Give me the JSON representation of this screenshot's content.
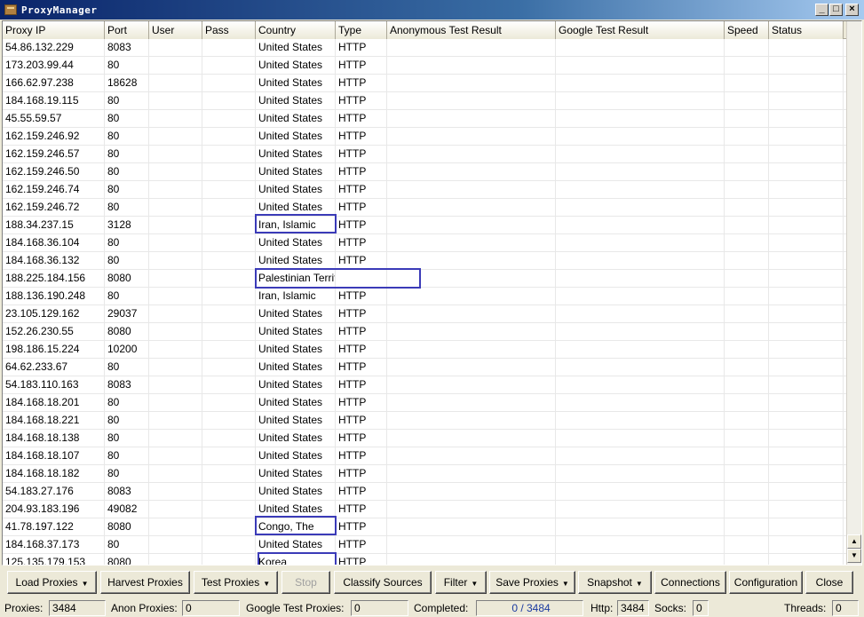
{
  "window": {
    "title": "ProxyManager",
    "minimize": "_",
    "maximize": "□",
    "close": "×"
  },
  "columns": [
    "Proxy IP",
    "Port",
    "User",
    "Pass",
    "Country",
    "Type",
    "Anonymous Test Result",
    "Google Test Result",
    "Speed",
    "Status"
  ],
  "rows": [
    [
      "54.86.132.229",
      "8083",
      "",
      "",
      "United States",
      "HTTP",
      "",
      "",
      "",
      ""
    ],
    [
      "173.203.99.44",
      "80",
      "",
      "",
      "United States",
      "HTTP",
      "",
      "",
      "",
      ""
    ],
    [
      "166.62.97.238",
      "18628",
      "",
      "",
      "United States",
      "HTTP",
      "",
      "",
      "",
      ""
    ],
    [
      "184.168.19.115",
      "80",
      "",
      "",
      "United States",
      "HTTP",
      "",
      "",
      "",
      ""
    ],
    [
      "45.55.59.57",
      "80",
      "",
      "",
      "United States",
      "HTTP",
      "",
      "",
      "",
      ""
    ],
    [
      "162.159.246.92",
      "80",
      "",
      "",
      "United States",
      "HTTP",
      "",
      "",
      "",
      ""
    ],
    [
      "162.159.246.57",
      "80",
      "",
      "",
      "United States",
      "HTTP",
      "",
      "",
      "",
      ""
    ],
    [
      "162.159.246.50",
      "80",
      "",
      "",
      "United States",
      "HTTP",
      "",
      "",
      "",
      ""
    ],
    [
      "162.159.246.74",
      "80",
      "",
      "",
      "United States",
      "HTTP",
      "",
      "",
      "",
      ""
    ],
    [
      "162.159.246.72",
      "80",
      "",
      "",
      "United States",
      "HTTP",
      "",
      "",
      "",
      ""
    ],
    [
      "188.34.237.15",
      "3128",
      "",
      "",
      "Iran, Islamic",
      "HTTP",
      "",
      "",
      "",
      ""
    ],
    [
      "184.168.36.104",
      "80",
      "",
      "",
      "United States",
      "HTTP",
      "",
      "",
      "",
      ""
    ],
    [
      "184.168.36.132",
      "80",
      "",
      "",
      "United States",
      "HTTP",
      "",
      "",
      "",
      ""
    ],
    [
      "188.225.184.156",
      "8080",
      "",
      "",
      "Palestinian Territory, Occupied",
      "",
      "",
      "",
      "",
      ""
    ],
    [
      "188.136.190.248",
      "80",
      "",
      "",
      "Iran, Islamic",
      "HTTP",
      "",
      "",
      "",
      ""
    ],
    [
      "23.105.129.162",
      "29037",
      "",
      "",
      "United States",
      "HTTP",
      "",
      "",
      "",
      ""
    ],
    [
      "152.26.230.55",
      "8080",
      "",
      "",
      "United States",
      "HTTP",
      "",
      "",
      "",
      ""
    ],
    [
      "198.186.15.224",
      "10200",
      "",
      "",
      "United States",
      "HTTP",
      "",
      "",
      "",
      ""
    ],
    [
      "64.62.233.67",
      "80",
      "",
      "",
      "United States",
      "HTTP",
      "",
      "",
      "",
      ""
    ],
    [
      "54.183.110.163",
      "8083",
      "",
      "",
      "United States",
      "HTTP",
      "",
      "",
      "",
      ""
    ],
    [
      "184.168.18.201",
      "80",
      "",
      "",
      "United States",
      "HTTP",
      "",
      "",
      "",
      ""
    ],
    [
      "184.168.18.221",
      "80",
      "",
      "",
      "United States",
      "HTTP",
      "",
      "",
      "",
      ""
    ],
    [
      "184.168.18.138",
      "80",
      "",
      "",
      "United States",
      "HTTP",
      "",
      "",
      "",
      ""
    ],
    [
      "184.168.18.107",
      "80",
      "",
      "",
      "United States",
      "HTTP",
      "",
      "",
      "",
      ""
    ],
    [
      "184.168.18.182",
      "80",
      "",
      "",
      "United States",
      "HTTP",
      "",
      "",
      "",
      ""
    ],
    [
      "54.183.27.176",
      "8083",
      "",
      "",
      "United States",
      "HTTP",
      "",
      "",
      "",
      ""
    ],
    [
      "204.93.183.196",
      "49082",
      "",
      "",
      "United States",
      "HTTP",
      "",
      "",
      "",
      ""
    ],
    [
      "41.78.197.122",
      "8080",
      "",
      "",
      "Congo, The",
      "HTTP",
      "",
      "",
      "",
      ""
    ],
    [
      "184.168.37.173",
      "80",
      "",
      "",
      "United States",
      "HTTP",
      "",
      "",
      "",
      ""
    ],
    [
      "125.135.179.153",
      "8080",
      "",
      "",
      "Korea",
      "HTTP",
      "",
      "",
      "",
      ""
    ]
  ],
  "scrollbar": {
    "up": "▲",
    "down": "▼"
  },
  "toolbar": {
    "load": "Load Proxies",
    "harvest": "Harvest Proxies",
    "test": "Test Proxies",
    "stop": "Stop",
    "classify": "Classify Sources",
    "filter": "Filter",
    "save": "Save Proxies",
    "snapshot": "Snapshot",
    "connections": "Connections",
    "configuration": "Configuration",
    "close": "Close",
    "dropdown_arrow": "▼"
  },
  "status": {
    "proxies_label": "Proxies:",
    "proxies_value": "3484",
    "anon_label": "Anon Proxies:",
    "anon_value": "0",
    "google_label": "Google Test Proxies:",
    "google_value": "0",
    "completed_label": "Completed:",
    "completed_value": "0 / 3484",
    "http_label": "Http:",
    "http_value": "3484",
    "socks_label": "Socks:",
    "socks_value": "0",
    "threads_label": "Threads:",
    "threads_value": "0"
  },
  "colors": {
    "highlight": "#3b3bb8",
    "completed_text": "#1a3aa0"
  }
}
